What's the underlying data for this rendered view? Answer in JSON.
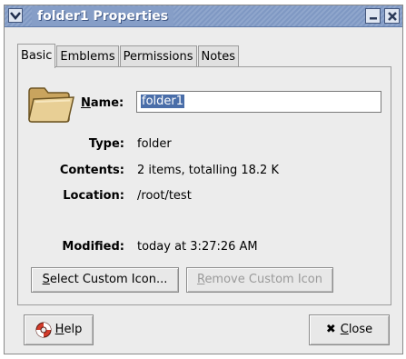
{
  "window": {
    "title": "folder1 Properties"
  },
  "tabs": [
    {
      "label": "Basic",
      "active": true
    },
    {
      "label": "Emblems",
      "active": false
    },
    {
      "label": "Permissions",
      "active": false
    },
    {
      "label": "Notes",
      "active": false
    }
  ],
  "basic": {
    "name_label": "Name:",
    "name_value": "folder1",
    "rows": [
      {
        "label": "Type:",
        "value": "folder"
      },
      {
        "label": "Contents:",
        "value": "2 items, totalling 18.2 K"
      },
      {
        "label": "Location:",
        "value": "/root/test"
      },
      {
        "label": "Modified:",
        "value": "today at 3:27:26 AM"
      }
    ],
    "select_icon_label": "elect Custom Icon...",
    "select_icon_mnemonic": "S",
    "remove_icon_label": "emove Custom Icon",
    "remove_icon_mnemonic": "R"
  },
  "footer": {
    "help_mnemonic": "H",
    "help_label": "elp",
    "close_mnemonic": "C",
    "close_label": "lose"
  },
  "icons": {
    "window_menu": "chevron-down-icon",
    "minimize": "minimize-icon",
    "close": "close-icon",
    "folder": "folder-icon",
    "help": "lifebuoy-icon"
  },
  "colors": {
    "titlebar": "#869ec7",
    "selection": "#4a6ea9",
    "window_bg": "#ececec"
  }
}
